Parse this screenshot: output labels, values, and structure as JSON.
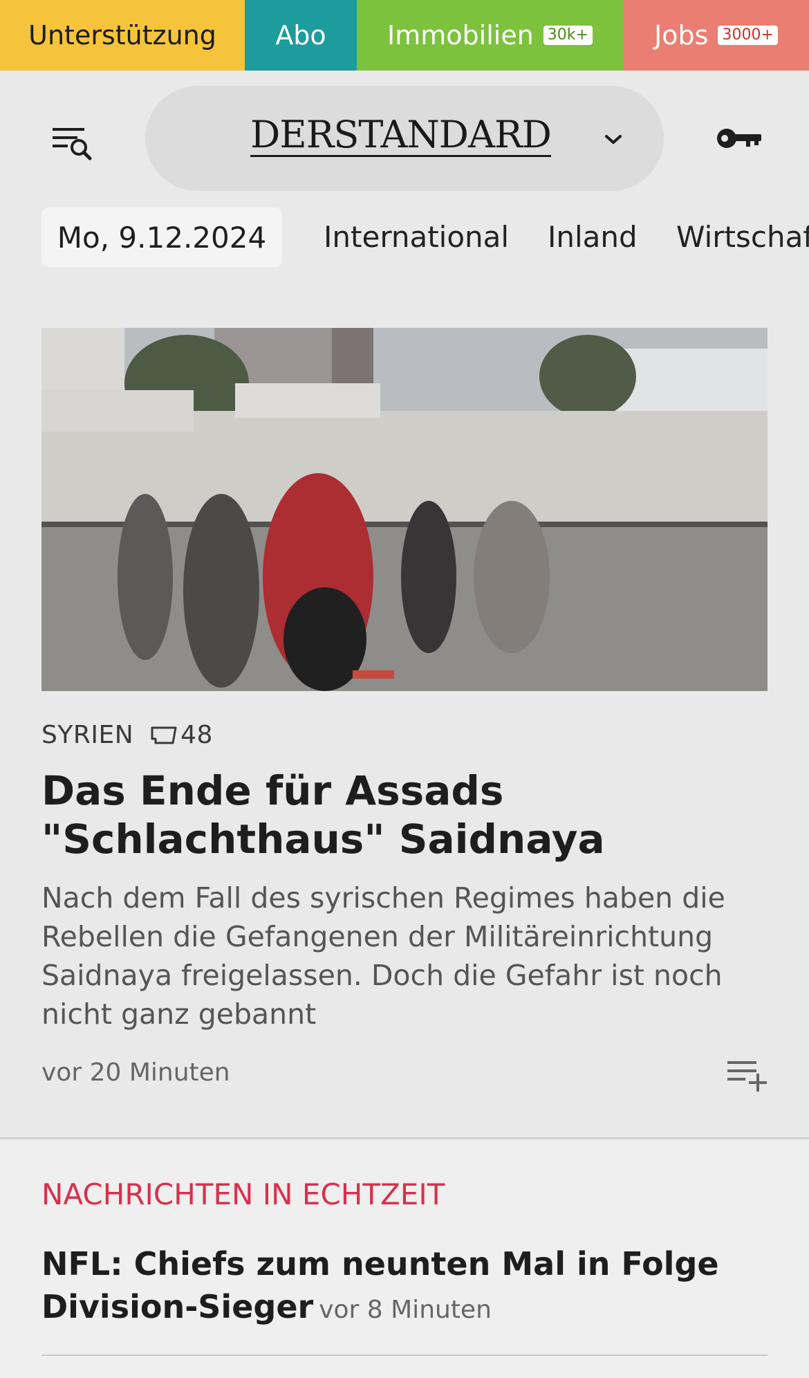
{
  "promo": {
    "support": "Unterstützung",
    "abo": "Abo",
    "immobilien": "Immobilien",
    "immobilien_badge": "30k+",
    "jobs": "Jobs",
    "jobs_badge": "3000+"
  },
  "header": {
    "logo": "DERSTANDARD",
    "menu_icon": "menu-search-icon",
    "key_icon": "key-icon"
  },
  "nav": {
    "date": "Mo, 9.12.2024",
    "items": [
      "International",
      "Inland",
      "Wirtschaft"
    ]
  },
  "teaser": {
    "kicker": "SYRIEN",
    "comments": "48",
    "headline": "Das Ende für Assads \"Schlachthaus\" Saidnaya",
    "lead": "Nach dem Fall des syrischen Regimes haben die Rebellen die Gefangenen der Militäreinrichtung Saidnaya freigelassen. Doch die Gefahr ist noch nicht ganz gebannt",
    "time": "vor 20 Minuten"
  },
  "live": {
    "title": "NACHRICHTEN IN ECHTZEIT",
    "items": [
      {
        "headline": "NFL: Chiefs zum neunten Mal in Folge Division-Sieger",
        "time": "vor 8 Minuten"
      }
    ]
  }
}
